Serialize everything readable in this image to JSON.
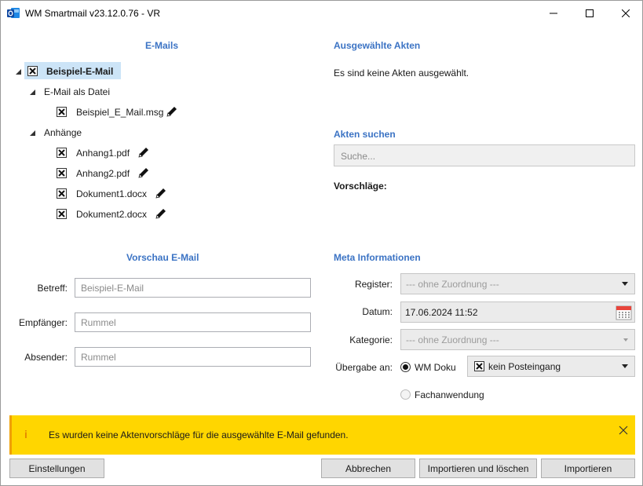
{
  "window": {
    "title": "WM Smartmail v23.12.0.76 - VR",
    "controls": {
      "minimize_icon": "minimize-icon",
      "maximize_icon": "maximize-icon",
      "close_icon": "close-icon"
    }
  },
  "emails": {
    "heading": "E-Mails",
    "root": {
      "label": "Beispiel-E-Mail",
      "checked": true,
      "expanded": true
    },
    "groups": [
      {
        "label": "E-Mail als Datei",
        "expanded": true,
        "items": [
          {
            "label": "Beispiel_E_Mail.msg",
            "checked": true,
            "editable": true
          }
        ]
      },
      {
        "label": "Anhänge",
        "expanded": true,
        "items": [
          {
            "label": "Anhang1.pdf",
            "checked": true,
            "editable": true
          },
          {
            "label": "Anhang2.pdf",
            "checked": true,
            "editable": true
          },
          {
            "label": "Dokument1.docx",
            "checked": true,
            "editable": true
          },
          {
            "label": "Dokument2.docx",
            "checked": true,
            "editable": true
          }
        ]
      }
    ]
  },
  "selected_files": {
    "heading": "Ausgewählte Akten",
    "empty_text": "Es sind keine Akten ausgewählt."
  },
  "search": {
    "heading": "Akten suchen",
    "placeholder": "Suche...",
    "suggestions_label": "Vorschläge:"
  },
  "preview": {
    "heading": "Vorschau E-Mail",
    "fields": [
      {
        "label": "Betreff:",
        "value": "Beispiel-E-Mail"
      },
      {
        "label": "Empfänger:",
        "value": "Rummel"
      },
      {
        "label": "Absender:",
        "value": "Rummel"
      }
    ]
  },
  "meta": {
    "heading": "Meta Informationen",
    "register": {
      "label": "Register:",
      "value": "--- ohne Zuordnung ---"
    },
    "date": {
      "label": "Datum:",
      "value": "17.06.2024 11:52"
    },
    "category": {
      "label": "Kategorie:",
      "value": "--- ohne Zuordnung ---"
    },
    "handover": {
      "label": "Übergabe an:",
      "options": [
        {
          "label": "WM Doku",
          "selected": true,
          "enabled": true
        },
        {
          "label": "Fachanwendung",
          "selected": false,
          "enabled": false
        }
      ],
      "inbox": {
        "value": "kein Posteingang",
        "checked": true
      }
    }
  },
  "notification": {
    "icon": "info-icon",
    "glyph": "i",
    "text": "Es wurden keine Aktenvorschläge für die ausgewählte E-Mail gefunden.",
    "color": "#FFD600",
    "accent": "#F0A000"
  },
  "buttons": {
    "settings": "Einstellungen",
    "cancel": "Abbrechen",
    "import_delete": "Importieren und löschen",
    "import": "Importieren"
  },
  "colors": {
    "heading": "#3B73C4",
    "selection": "#CCE4F7"
  }
}
